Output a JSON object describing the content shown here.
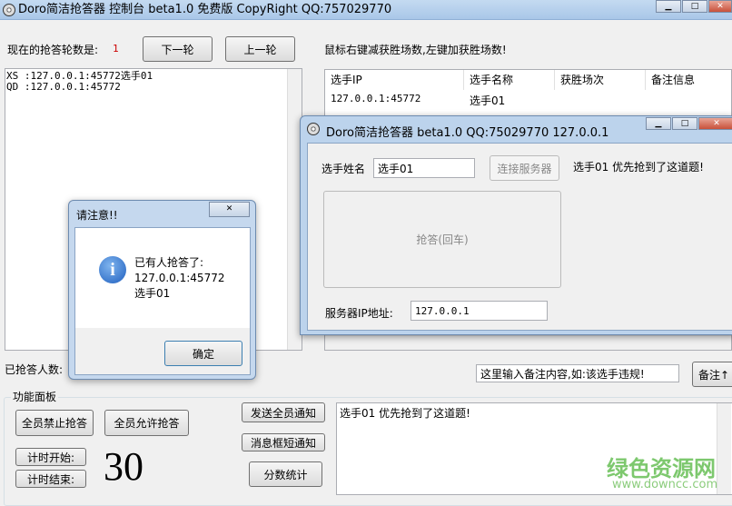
{
  "main_window": {
    "title": "Doro简洁抢答器 控制台 beta1.0 免费版  CopyRight QQ:757029770"
  },
  "round": {
    "label": "现在的抢答轮数是:",
    "value": "1",
    "next_label": "下一轮",
    "prev_label": "上一轮"
  },
  "hint": "鼠标右键减获胜场数,左键加获胜场数!",
  "log": [
    "XS :127.0.0.1:45772选手01",
    "QD :127.0.0.1:45772"
  ],
  "table": {
    "headers": [
      "选手IP",
      "选手名称",
      "获胜场次",
      "备注信息"
    ],
    "rows": [
      [
        "127.0.0.1:45772",
        "选手01",
        "",
        ""
      ]
    ]
  },
  "answered_label": "已抢答人数:",
  "remark": {
    "value": "这里输入备注内容,如:该选手违规!",
    "button": "备注↑"
  },
  "panel": {
    "title": "功能面板",
    "ban_all": "全员禁止抢答",
    "allow_all": "全员允许抢答",
    "timer_start": "计时开始:",
    "timer_end": "计时结束:",
    "timer_value": "30",
    "notify_all": "发送全员通知",
    "msgbox_notify": "消息框短通知",
    "score_stats": "分数统计",
    "message_text": "选手01 优先抢到了这道题!"
  },
  "client_window": {
    "title": "Doro简洁抢答器 beta1.0 QQ:75029770  127.0.0.1",
    "name_label": "选手姓名",
    "name_value": "选手01",
    "connect_label": "连接服务器",
    "status": "选手01 优先抢到了这道题!",
    "answer_button": "抢答(回车)",
    "server_ip_label": "服务器IP地址:",
    "server_ip_value": "127.0.0.1"
  },
  "dialog": {
    "title": "请注意!!",
    "line1": "已有人抢答了:",
    "line2": "127.0.0.1:45772",
    "line3": "选手01",
    "ok": "确定"
  },
  "watermark": {
    "cn": "绿色资源网",
    "url": "www.downcc.com"
  }
}
